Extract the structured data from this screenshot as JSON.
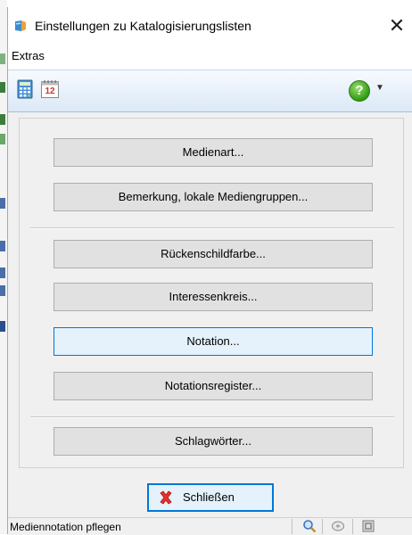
{
  "window": {
    "title": "Einstellungen zu Katalogisierungslisten",
    "close_glyph": "✕"
  },
  "menu": {
    "items": [
      "Extras"
    ]
  },
  "toolbar": {
    "calculator_icon": "calculator-icon",
    "calendar_icon": "calendar-icon",
    "calendar_day": "12",
    "help_glyph": "?",
    "help_dropdown_glyph": "▼"
  },
  "buttons": {
    "medienart": "Medienart...",
    "bemerkung": "Bemerkung, lokale Mediengruppen...",
    "rueckenschildfarbe": "Rückenschildfarbe...",
    "interessenkreis": "Interessenkreis...",
    "notation": "Notation...",
    "notationsregister": "Notationsregister...",
    "schlagwoerter": "Schlagwörter..."
  },
  "footer": {
    "close_label": "Schließen"
  },
  "status": {
    "text": "Mediennotation pflegen"
  },
  "colors": {
    "accent": "#0078d7",
    "button_bg": "#e1e1e1",
    "focused_bg": "#e5f1fb",
    "close_icon": "#e8322b"
  }
}
